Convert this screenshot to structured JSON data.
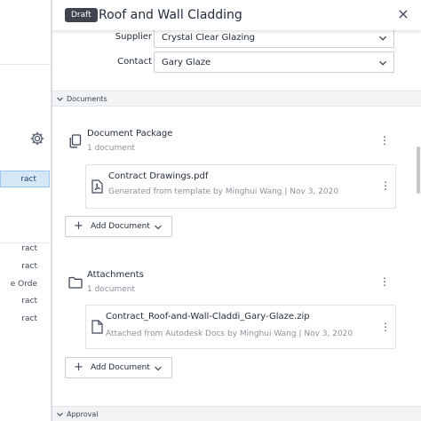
{
  "sidebar": {
    "items": [
      "ract",
      "ract",
      "ract",
      "e Orde",
      "ract",
      "ract"
    ],
    "selected_index": 0
  },
  "panel": {
    "badge": "Draft",
    "title": "Roof and Wall Cladding",
    "close_icon": "×",
    "form": {
      "supplier_label": "Supplier",
      "supplier_value": "Crystal Clear Glazing",
      "contact_label": "Contact",
      "contact_value": "Gary Glaze"
    },
    "documents_section": {
      "label": "Documents",
      "document_package": {
        "title": "Document Package",
        "count": "1 document",
        "file": {
          "name": "Contract Drawings.pdf",
          "meta": "Generated from template by Minghui Wang | Nov 3, 2020"
        },
        "add_label": "Add Document"
      },
      "attachments": {
        "title": "Attachments",
        "count": "1 document",
        "file": {
          "name": "Contract_Roof-and-Wall-Claddi_Gary-Glaze.zip",
          "meta": "Attached from Autodesk Docs by Minghui Wang | Nov 3, 2020"
        },
        "add_label": "Add Document"
      }
    },
    "approval_section": {
      "label": "Approval"
    }
  },
  "colors": {
    "badge_bg": "#3d4450",
    "selected_bg": "#d6e7f8",
    "text": "#1f2a38",
    "muted": "#8a929c"
  }
}
